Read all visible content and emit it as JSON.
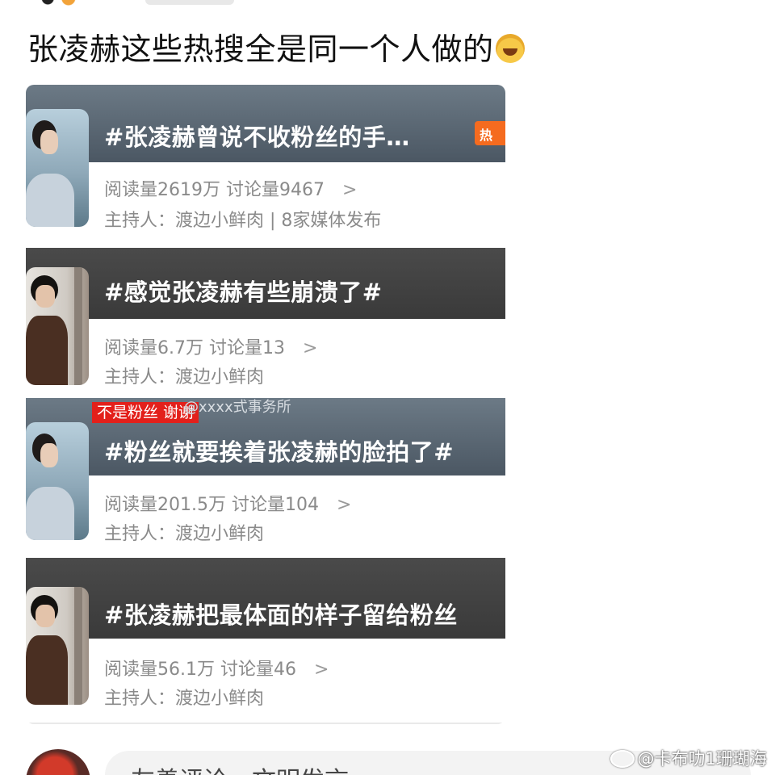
{
  "post": {
    "text": "张凌赫这些热搜全是同一个人做的",
    "emoji": "laughing-crying-emoji"
  },
  "cards": [
    {
      "title": "#张凌赫曾说不收粉丝的手…",
      "badge": "热",
      "stats": "阅读量2619万 讨论量9467",
      "host": "主持人：渡边小鲜肉 | 8家媒体发布"
    },
    {
      "title": "#感觉张凌赫有些崩溃了#",
      "stats": "阅读量6.7万 讨论量13",
      "host": "主持人：渡边小鲜肉"
    },
    {
      "title": "#粉丝就要挨着张凌赫的脸拍了#",
      "stats": "阅读量201.5万 讨论量104",
      "host": "主持人：渡边小鲜肉"
    },
    {
      "title": "#张凌赫把最体面的样子留给粉丝",
      "stats": "阅读量56.1万 讨论量46",
      "host": "主持人：渡边小鲜肉"
    }
  ],
  "overlay": {
    "red_label": "不是粉丝 谢谢",
    "inner_watermark": "@xxxx式事务所"
  },
  "comment": {
    "placeholder": "友善评论，文明发言"
  },
  "watermark": {
    "text": "@卡布叻1珊瑚海"
  },
  "colors": {
    "hot_badge": "#f56b1f",
    "red_label": "#e3201b",
    "stats_text": "#8a8a8a"
  }
}
